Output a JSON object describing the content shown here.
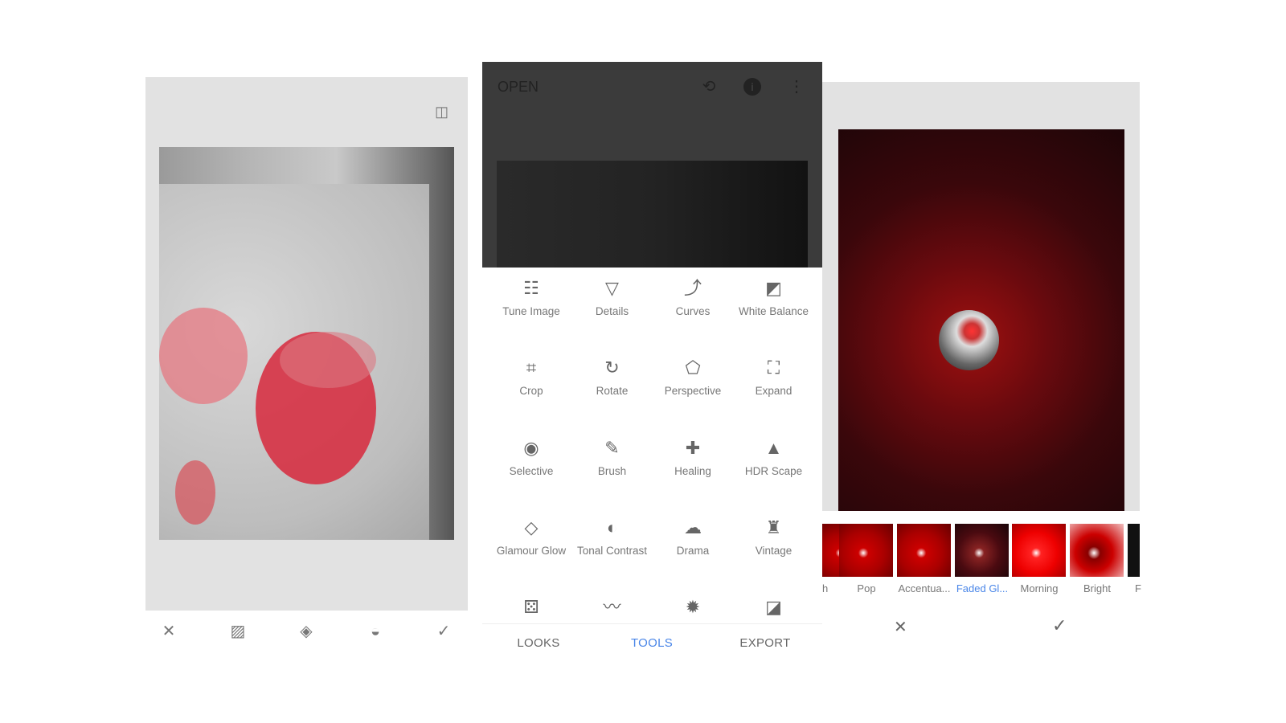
{
  "left_panel": {
    "toolbar": [
      {
        "icon": "close-icon"
      },
      {
        "icon": "add-image-icon"
      },
      {
        "icon": "layers-icon"
      },
      {
        "icon": "drop-icon"
      },
      {
        "icon": "check-icon"
      }
    ],
    "compare_icon": "compare-icon"
  },
  "middle_panel": {
    "header": {
      "title": "OPEN",
      "icons": [
        "layers-undo-icon",
        "info-icon",
        "more-icon"
      ]
    },
    "tools": [
      {
        "label": "Tune Image",
        "icon": "☷"
      },
      {
        "label": "Details",
        "icon": "▽"
      },
      {
        "label": "Curves",
        "icon": "⤴"
      },
      {
        "label": "White Balance",
        "icon": "◩"
      },
      {
        "label": "Crop",
        "icon": "⌗"
      },
      {
        "label": "Rotate",
        "icon": "↻"
      },
      {
        "label": "Perspective",
        "icon": "⬠"
      },
      {
        "label": "Expand",
        "icon": "⛶"
      },
      {
        "label": "Selective",
        "icon": "◉"
      },
      {
        "label": "Brush",
        "icon": "✎"
      },
      {
        "label": "Healing",
        "icon": "✚"
      },
      {
        "label": "HDR Scape",
        "icon": "▲"
      },
      {
        "label": "Glamour Glow",
        "icon": "◇"
      },
      {
        "label": "Tonal Contrast",
        "icon": "◐"
      },
      {
        "label": "Drama",
        "icon": "☁"
      },
      {
        "label": "Vintage",
        "icon": "♜"
      },
      {
        "label": "",
        "icon": "⚄"
      },
      {
        "label": "",
        "icon": "〰"
      },
      {
        "label": "",
        "icon": "✹"
      },
      {
        "label": "",
        "icon": "◪"
      }
    ],
    "tabs": [
      {
        "label": "LOOKS"
      },
      {
        "label": "TOOLS",
        "active": true
      },
      {
        "label": "EXPORT"
      }
    ]
  },
  "right_panel": {
    "filters": [
      {
        "label": "h"
      },
      {
        "label": "Pop"
      },
      {
        "label": "Accentua..."
      },
      {
        "label": "Faded Gl...",
        "selected": true
      },
      {
        "label": "Morning"
      },
      {
        "label": "Bright"
      },
      {
        "label": "F"
      }
    ],
    "actions": [
      {
        "icon": "close-icon"
      },
      {
        "icon": "check-icon"
      }
    ]
  },
  "colors": {
    "accent": "#4a86e8",
    "header_bg": "#3b3b3b"
  }
}
